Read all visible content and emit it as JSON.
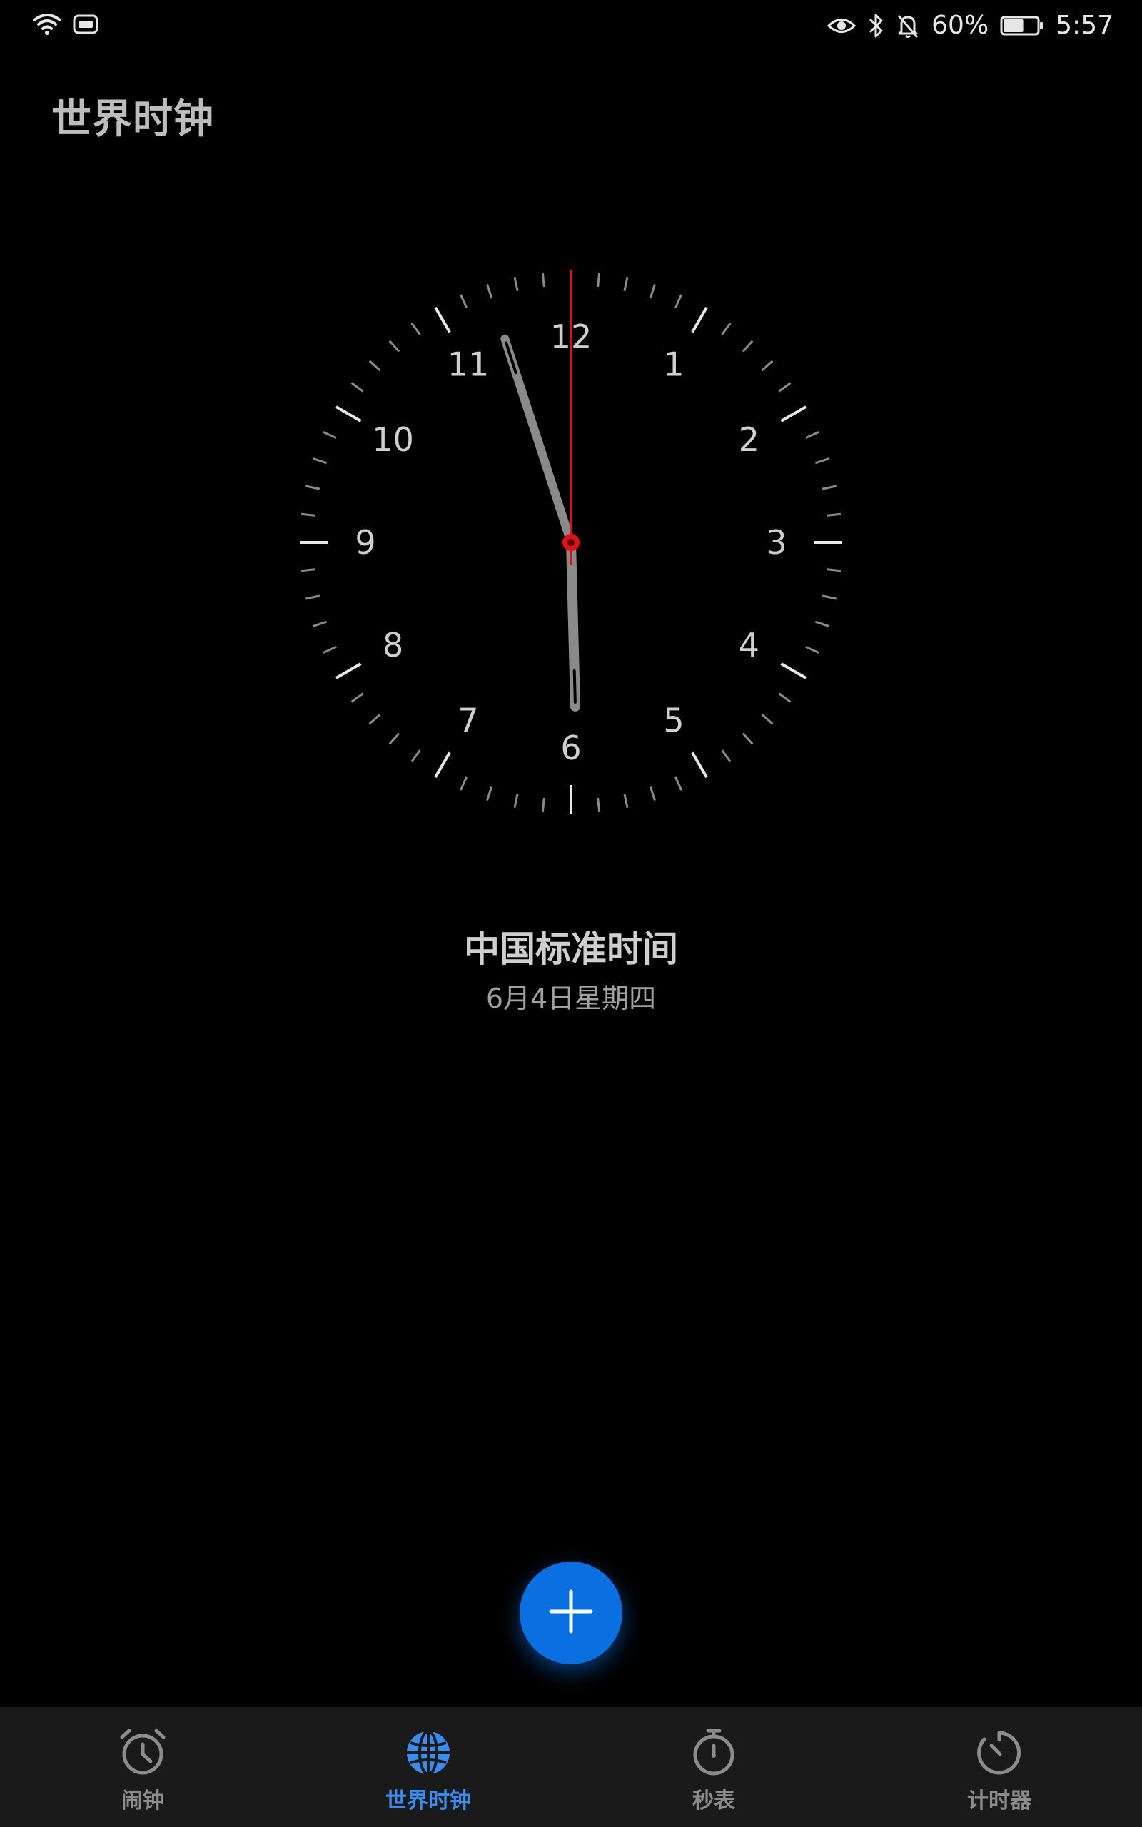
{
  "status_bar": {
    "battery_percent": "60%",
    "time": "5:57",
    "battery_level": 0.6,
    "icons_left": [
      "wifi-icon",
      "hd-icon"
    ],
    "icons_right": [
      "eye-comfort-icon",
      "bluetooth-icon",
      "mute-icon",
      "battery-icon"
    ]
  },
  "page": {
    "title": "世界时钟"
  },
  "clock": {
    "numerals": [
      "12",
      "1",
      "2",
      "3",
      "4",
      "5",
      "6",
      "7",
      "8",
      "9",
      "10",
      "11"
    ],
    "time_shown": {
      "hour": 5,
      "minute": 57,
      "second": 0
    },
    "hand_color": "#8a8a8a",
    "second_hand_color": "#e0101a"
  },
  "city": {
    "name": "中国标准时间",
    "date": "6月4日星期四"
  },
  "fab": {
    "icon": "plus-icon",
    "color": "#0a6fe0"
  },
  "tabs": [
    {
      "label": "闹钟",
      "icon": "alarm-clock-icon",
      "active": false
    },
    {
      "label": "世界时钟",
      "icon": "globe-icon",
      "active": true
    },
    {
      "label": "秒表",
      "icon": "stopwatch-icon",
      "active": false
    },
    {
      "label": "计时器",
      "icon": "timer-icon",
      "active": false
    }
  ],
  "colors": {
    "accent": "#3a8df0",
    "background": "#000000",
    "tabbar": "#1a1a1a"
  }
}
